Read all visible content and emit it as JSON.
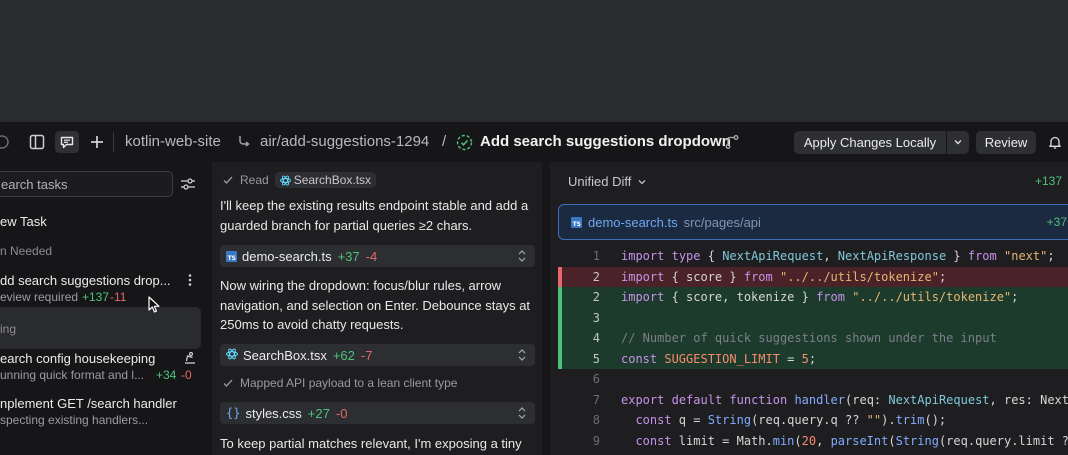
{
  "topbar": {
    "repo": "kotlin-web-site",
    "branch": "air/add-suggestions-1294",
    "separator": "/",
    "task_title": "Add search suggestions dropdown",
    "apply_label": "Apply Changes Locally",
    "review_label": "Review"
  },
  "sidebar": {
    "search_placeholder": "earch tasks",
    "new_task": "ew Task",
    "section_needed": "n Needed",
    "section_working": "ing",
    "tasks": [
      {
        "title": "dd search suggestions drop...",
        "sub": "eview required",
        "add": "+137",
        "del": "-11"
      },
      {
        "title": "earch config housekeeping",
        "sub": "unning quick format and l...",
        "add": "+34",
        "del": "-0"
      },
      {
        "title": "nplement GET /search handler",
        "sub": "specting existing handlers..."
      }
    ]
  },
  "chat": {
    "read_label": "Read",
    "read_file": "SearchBox.tsx",
    "para1": "I'll keep the existing results endpoint stable and add a guarded branch for partial queries ≥2 chars.",
    "file1": {
      "name": "demo-search.ts",
      "add": "+37",
      "del": "-4"
    },
    "para2": "Now wiring the dropdown: focus/blur rules, arrow navigation, and selection on Enter. Debounce stays at 250ms to avoid chatty requests.",
    "file2": {
      "name": "SearchBox.tsx",
      "add": "+62",
      "del": "-7"
    },
    "step_label": "Mapped API payload to a lean client type",
    "file3": {
      "name": "styles.css",
      "add": "+27",
      "del": "-0"
    },
    "para3": "To keep partial matches relevant, I'm exposing a tiny"
  },
  "diff": {
    "mode_label": "Unified Diff",
    "total_add": "+137",
    "file_name": "demo-search.ts",
    "file_path": "src/pages/api",
    "file_add": "+37",
    "lines": [
      {
        "num": "1",
        "type": "ctx",
        "text": "import type { NextApiRequest, NextApiResponse } from \"next\";"
      },
      {
        "num": "2",
        "type": "rm",
        "text": "import { score } from \"../../utils/tokenize\";"
      },
      {
        "num": "2",
        "type": "ad",
        "text": "import { score, tokenize } from \"../../utils/tokenize\";"
      },
      {
        "num": "3",
        "type": "ad",
        "text": ""
      },
      {
        "num": "4",
        "type": "ad",
        "text": "// Number of quick suggestions shown under the input"
      },
      {
        "num": "5",
        "type": "ad",
        "text": "const SUGGESTION_LIMIT = 5;"
      },
      {
        "num": "6",
        "type": "ctx",
        "text": ""
      },
      {
        "num": "7",
        "type": "ctx",
        "text": "export default function handler(req: NextApiRequest, res: Next"
      },
      {
        "num": "8",
        "type": "ctx",
        "text": "  const q = String(req.query.q ?? \"\").trim();"
      },
      {
        "num": "9",
        "type": "ctx",
        "text": "  const limit = Math.min(20, parseInt(String(req.query.limit ?"
      }
    ]
  },
  "colors": {
    "accent_add": "#4ec27a",
    "accent_del": "#e5676b",
    "file_header_border": "#3c6fb8"
  }
}
